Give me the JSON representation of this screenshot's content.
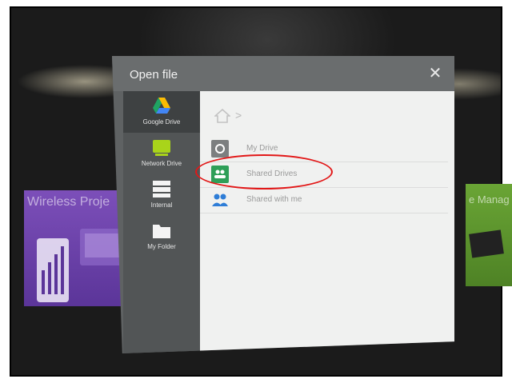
{
  "background": {
    "left_card_title": "Wireless Proje",
    "right_card_title": "e Manag"
  },
  "dialog": {
    "title": "Open file",
    "close_glyph": "✕"
  },
  "sidebar": {
    "items": [
      {
        "label": "Google Drive",
        "icon": "google-drive-icon",
        "active": true
      },
      {
        "label": "Network Drive",
        "icon": "network-drive-icon",
        "active": false
      },
      {
        "label": "Internal",
        "icon": "internal-storage-icon",
        "active": false
      },
      {
        "label": "My Folder",
        "icon": "folder-icon",
        "active": false
      }
    ]
  },
  "breadcrumb": {
    "home_icon": "home-icon",
    "separator": ">"
  },
  "files": {
    "rows": [
      {
        "label": "My Drive",
        "icon": "my-drive-icon"
      },
      {
        "label": "Shared Drives",
        "icon": "shared-drives-icon"
      },
      {
        "label": "Shared with me",
        "icon": "shared-with-me-icon"
      }
    ]
  },
  "colors": {
    "drive_green": "#2e9f58",
    "lime_icon": "#a9d41a",
    "annotation_red": "#e21818",
    "people_blue": "#2e7dd7"
  }
}
